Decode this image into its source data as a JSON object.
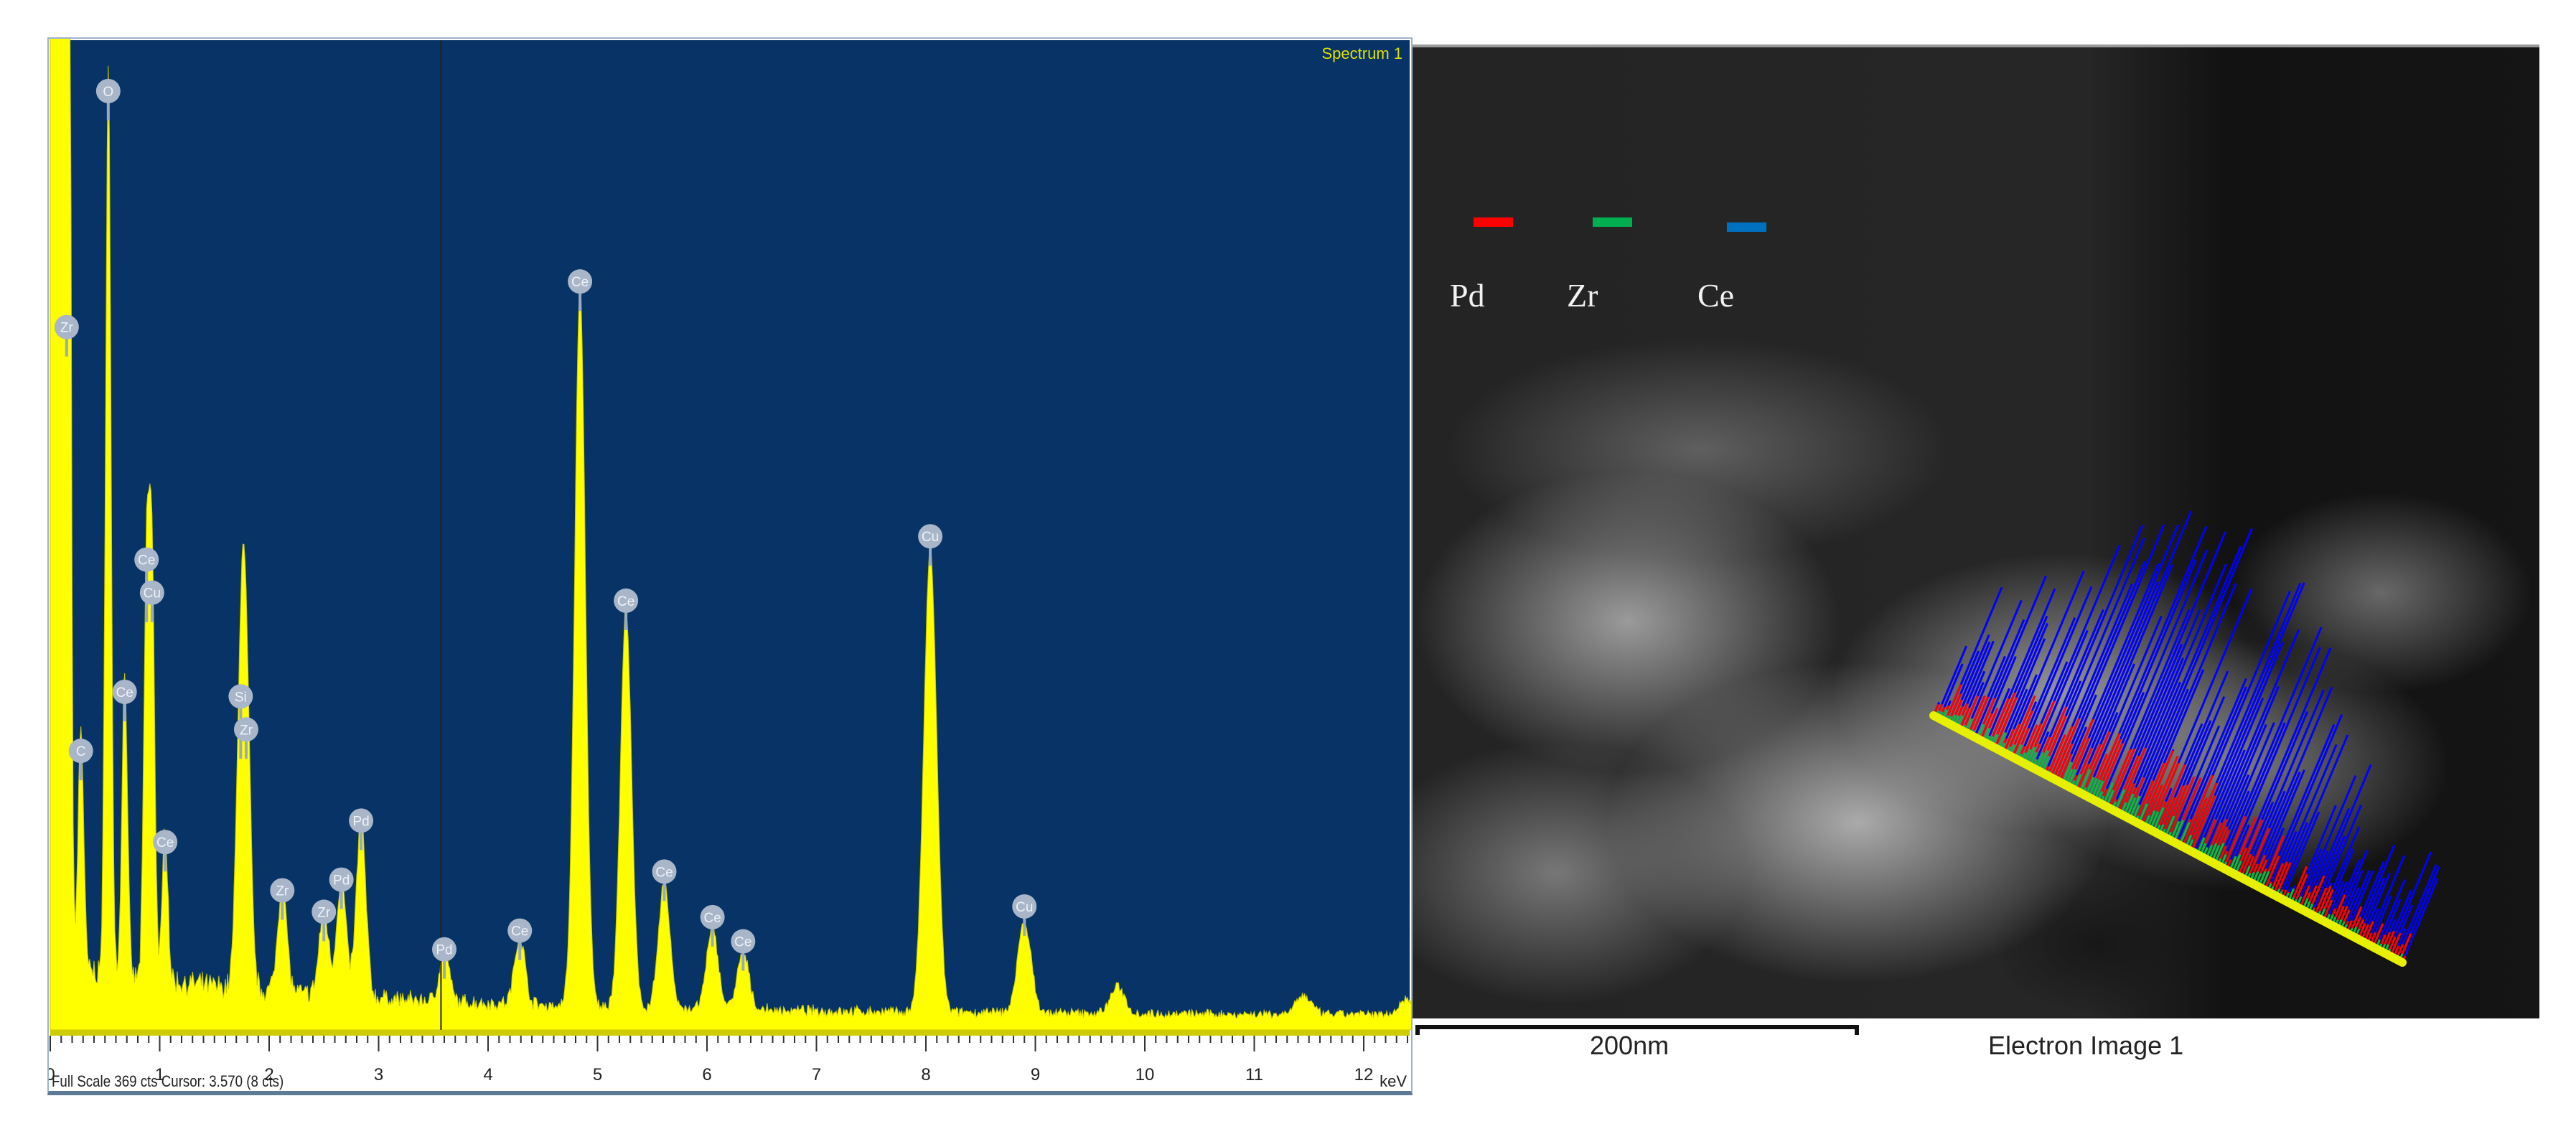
{
  "chart_data": {
    "type": "area",
    "title": "Spectrum 1",
    "xlabel": "keV",
    "ylabel": "cts",
    "xlim": [
      0,
      12.5
    ],
    "ylim": [
      0,
      369
    ],
    "xticks": [
      "0",
      "1",
      "2",
      "3",
      "4",
      "5",
      "6",
      "7",
      "8",
      "9",
      "10",
      "11",
      "12"
    ],
    "footer": "Full Scale 369 cts Cursor: 3.570  (8 cts)",
    "cursor_kev": 3.57,
    "grid": false,
    "peaks": [
      {
        "label": "Zr",
        "energy": 0.15,
        "counts": 1000,
        "marker_counts": 250
      },
      {
        "label": "C",
        "energy": 0.28,
        "counts": 92
      },
      {
        "label": "O",
        "energy": 0.53,
        "counts": 338
      },
      {
        "label": "Ce",
        "energy": 0.68,
        "counts": 114
      },
      {
        "label": "Ce",
        "energy": 0.88,
        "counts": 151,
        "stack": 1
      },
      {
        "label": "Cu",
        "energy": 0.93,
        "counts": 151
      },
      {
        "label": "Ce",
        "energy": 1.05,
        "counts": 58
      },
      {
        "label": "Si",
        "energy": 1.74,
        "counts": 100,
        "stack": 1
      },
      {
        "label": "Zr",
        "energy": 1.79,
        "counts": 100
      },
      {
        "label": "Zr",
        "energy": 2.12,
        "counts": 40
      },
      {
        "label": "Zr",
        "energy": 2.5,
        "counts": 32
      },
      {
        "label": "Pd",
        "energy": 2.66,
        "counts": 44
      },
      {
        "label": "Pd",
        "energy": 2.84,
        "counts": 66
      },
      {
        "label": "Pd",
        "energy": 3.6,
        "counts": 18
      },
      {
        "label": "Ce",
        "energy": 4.29,
        "counts": 25
      },
      {
        "label": "Ce",
        "energy": 4.84,
        "counts": 267
      },
      {
        "label": "Ce",
        "energy": 5.26,
        "counts": 148
      },
      {
        "label": "Ce",
        "energy": 5.61,
        "counts": 47
      },
      {
        "label": "Ce",
        "energy": 6.05,
        "counts": 30
      },
      {
        "label": "Ce",
        "energy": 6.33,
        "counts": 21
      },
      {
        "label": "Cu",
        "energy": 8.04,
        "counts": 172
      },
      {
        "label": "Cu",
        "energy": 8.9,
        "counts": 34
      }
    ],
    "minor_bumps": [
      {
        "energy": 9.75,
        "counts": 10
      },
      {
        "energy": 11.45,
        "counts": 7
      },
      {
        "energy": 12.4,
        "counts": 6
      }
    ]
  },
  "electron_image": {
    "caption": "Electron Image 1",
    "scale_bar": "200nm",
    "legend": [
      {
        "label": "Pd",
        "color": "#ff0000"
      },
      {
        "label": "Zr",
        "color": "#00b050"
      },
      {
        "label": "Ce",
        "color": "#0070c0"
      }
    ],
    "linescan_color": "#e6f000"
  }
}
